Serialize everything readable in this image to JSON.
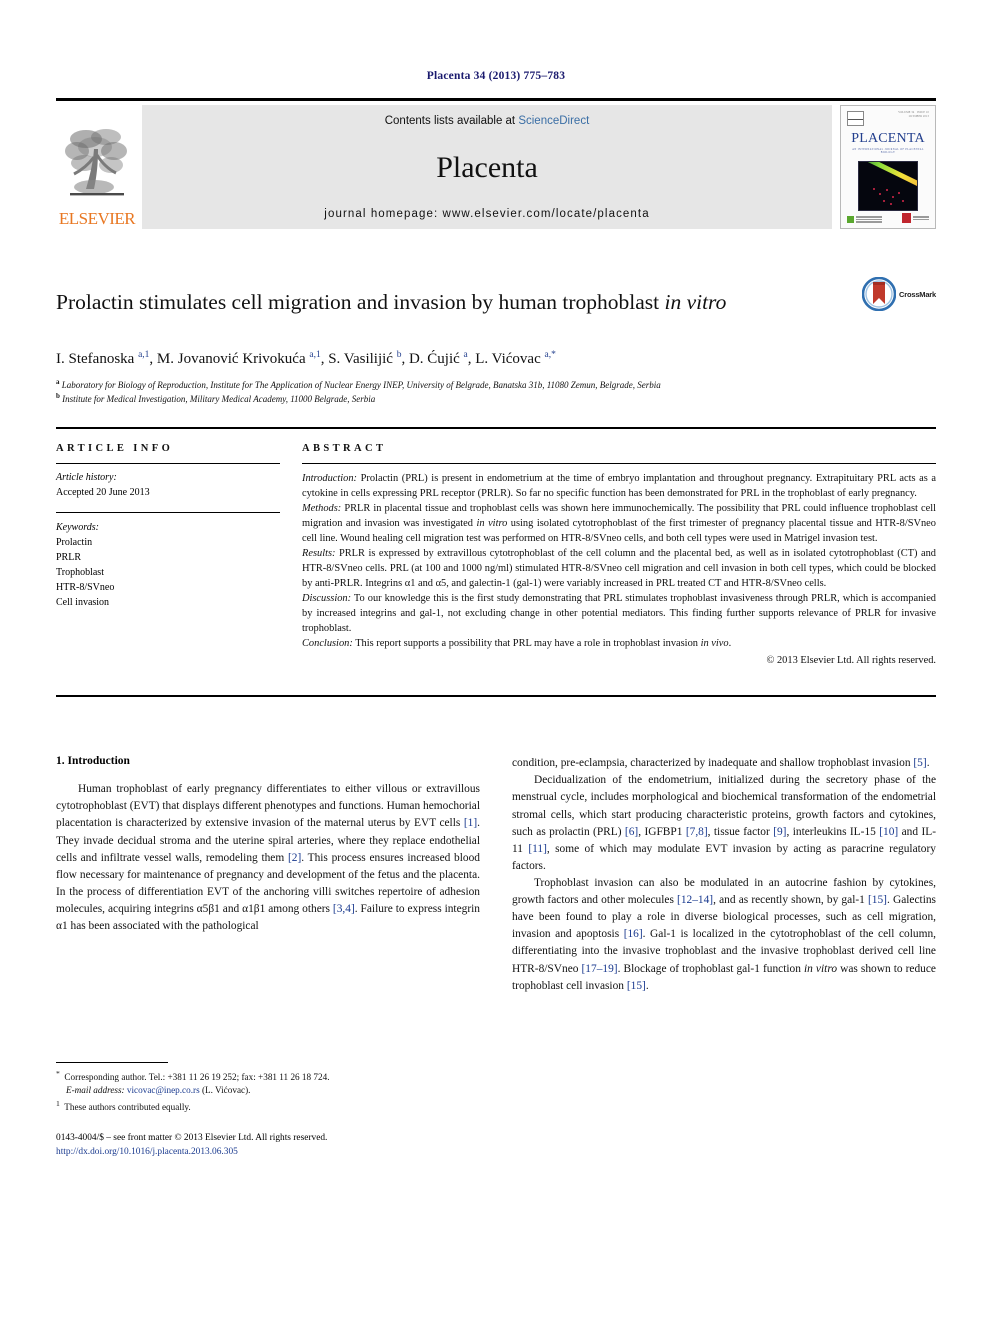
{
  "running_head": "Placenta 34 (2013) 775–783",
  "masthead": {
    "publisher": "ELSEVIER",
    "contents_prefix": "Contents lists available at ",
    "contents_link": "ScienceDirect",
    "journal_name": "Placenta",
    "homepage": "journal homepage: www.elsevier.com/locate/placenta",
    "cover": {
      "title": "PLACENTA",
      "subtitle": "AN INTERNATIONAL JOURNAL OF PLACENTAL BIOLOGY"
    }
  },
  "article": {
    "title_line1": "Prolactin stimulates cell migration and invasion by human trophoblast",
    "title_line2_italic": "in vitro",
    "crossmark_label": "CrossMark",
    "authors_html": "I. Stefanoska <sup>a,1</sup>, M. Jovanović Krivokuća <sup>a,1</sup>, S. Vasilijić <sup>b</sup>, D. Ćujić <sup>a</sup>, L. Vićovac <sup>a,*</sup>",
    "affiliation_a": "Laboratory for Biology of Reproduction, Institute for The Application of Nuclear Energy INEP, University of Belgrade, Banatska 31b, 11080 Zemun, Belgrade, Serbia",
    "affiliation_b": "Institute for Medical Investigation, Military Medical Academy, 11000 Belgrade, Serbia"
  },
  "article_info": {
    "heading": "ARTICLE INFO",
    "history_label": "Article history:",
    "history_value": "Accepted 20 June 2013",
    "keywords_label": "Keywords:",
    "keywords": [
      "Prolactin",
      "PRLR",
      "Trophoblast",
      "HTR-8/SVneo",
      "Cell invasion"
    ]
  },
  "abstract": {
    "heading": "ABSTRACT",
    "introduction_label": "Introduction:",
    "introduction_text": " Prolactin (PRL) is present in endometrium at the time of embryo implantation and throughout pregnancy. Extrapituitary PRL acts as a cytokine in cells expressing PRL receptor (PRLR). So far no specific function has been demonstrated for PRL in the trophoblast of early pregnancy.",
    "methods_label": "Methods:",
    "methods_text_1": " PRLR in placental tissue and trophoblast cells was shown here immunochemically. The possibility that PRL could influence trophoblast cell migration and invasion was investigated ",
    "methods_italic": "in vitro",
    "methods_text_2": " using isolated cytotrophoblast of the first trimester of pregnancy placental tissue and HTR-8/SVneo cell line. Wound healing cell migration test was performed on HTR-8/SVneo cells, and both cell types were used in Matrigel invasion test.",
    "results_label": "Results:",
    "results_text": " PRLR is expressed by extravillous cytotrophoblast of the cell column and the placental bed, as well as in isolated cytotrophoblast (CT) and HTR-8/SVneo cells. PRL (at 100 and 1000 ng/ml) stimulated HTR-8/SVneo cell migration and cell invasion in both cell types, which could be blocked by anti-PRLR. Integrins α1 and α5, and galectin-1 (gal-1) were variably increased in PRL treated CT and HTR-8/SVneo cells.",
    "discussion_label": "Discussion:",
    "discussion_text": " To our knowledge this is the first study demonstrating that PRL stimulates trophoblast invasiveness through PRLR, which is accompanied by increased integrins and gal-1, not excluding change in other potential mediators. This finding further supports relevance of PRLR for invasive trophoblast.",
    "conclusion_label": "Conclusion:",
    "conclusion_text_1": " This report supports a possibility that PRL may have a role in trophoblast invasion ",
    "conclusion_italic": "in vivo",
    "conclusion_text_2": ".",
    "copyright": "© 2013 Elsevier Ltd. All rights reserved."
  },
  "introduction": {
    "section_title": "1. Introduction",
    "left_para_1_html": "Human trophoblast of early pregnancy differentiates to either villous or extravillous cytotrophoblast (EVT) that displays different phenotypes and functions. Human hemochorial placentation is characterized by extensive invasion of the maternal uterus by EVT cells <span class=\"ref\">[1]</span>. They invade decidual stroma and the uterine spiral arteries, where they replace endothelial cells and infiltrate vessel walls, remodeling them <span class=\"ref\">[2]</span>. This process ensures increased blood flow necessary for maintenance of pregnancy and development of the fetus and the placenta. In the process of differentiation EVT of the anchoring villi switches repertoire of adhesion molecules, acquiring integrins α5β1 and α1β1 among others <span class=\"ref\">[3,4]</span>. Failure to express integrin α1 has been associated with the pathological",
    "right_para_1_html": "condition, pre-eclampsia, characterized by inadequate and shallow trophoblast invasion <span class=\"ref\">[5]</span>.",
    "right_para_2_html": "Decidualization of the endometrium, initialized during the secretory phase of the menstrual cycle, includes morphological and biochemical transformation of the endometrial stromal cells, which start producing characteristic proteins, growth factors and cytokines, such as prolactin (PRL) <span class=\"ref\">[6]</span>, IGFBP1 <span class=\"ref\">[7,8]</span>, tissue factor <span class=\"ref\">[9]</span>, interleukins IL-15 <span class=\"ref\">[10]</span> and IL-11 <span class=\"ref\">[11]</span>, some of which may modulate EVT invasion by acting as paracrine regulatory factors.",
    "right_para_3_html": "Trophoblast invasion can also be modulated in an autocrine fashion by cytokines, growth factors and other molecules <span class=\"ref\">[12–14]</span>, and as recently shown, by gal-1 <span class=\"ref\">[15]</span>. Galectins have been found to play a role in diverse biological processes, such as cell migration, invasion and apoptosis <span class=\"ref\">[16]</span>. Gal-1 is localized in the cytotrophoblast of the cell column, differentiating into the invasive trophoblast and the invasive trophoblast derived cell line HTR-8/SVneo <span class=\"ref\">[17–19]</span>. Blockage of trophoblast gal-1 function <span class=\"ital\">in vitro</span> was shown to reduce trophoblast cell invasion <span class=\"ref\">[15]</span>."
  },
  "footnotes": {
    "corresponding_html": "<sup>*</sup>&nbsp; Corresponding author. Tel.: +381 11 26 19 252; fax: +381 11 26 18 724.",
    "email_html": "<span class=\"mail\">E-mail address:</span> <span class=\"mail-link\">vicovac@inep.co.rs</span> (L. Vićovac).",
    "equal_html": "<sup>1</sup>&nbsp; These authors contributed equally.",
    "issn_line": "0143-4004/$ – see front matter © 2013 Elsevier Ltd. All rights reserved.",
    "doi": "http://dx.doi.org/10.1016/j.placenta.2013.06.305"
  }
}
